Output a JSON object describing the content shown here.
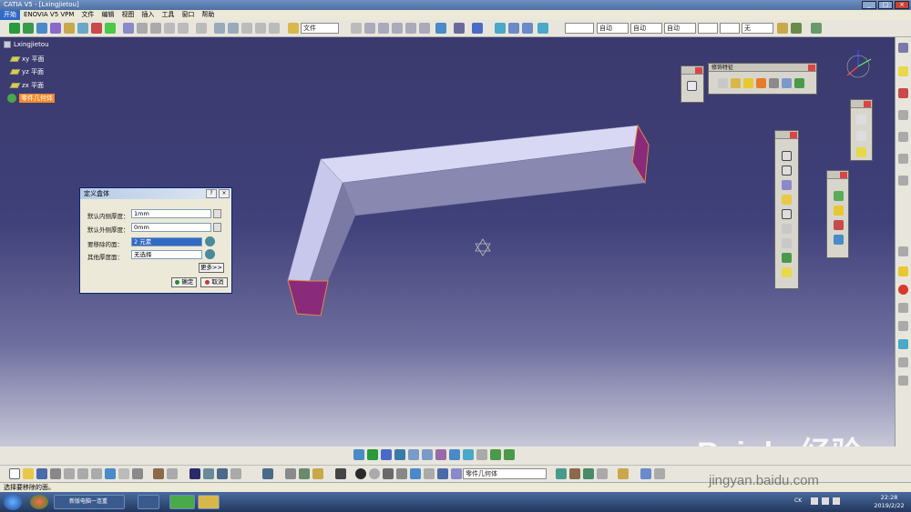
{
  "window": {
    "title": "CATIA V5 - [Lxingjietou]",
    "controls": [
      "_",
      "□",
      "×"
    ]
  },
  "menu": [
    "开始",
    "ENOVIA V5 VPM",
    "文件",
    "编辑",
    "视图",
    "插入",
    "工具",
    "窗口",
    "帮助"
  ],
  "toolbar": {
    "file_select": "文件",
    "line_style": "自动",
    "line_weight": "自动",
    "color": "自动",
    "layer": "无"
  },
  "tree": {
    "root": "Lxingjietou",
    "items": [
      "xy 平面",
      "yz 平面",
      "zx 平面",
      "零件几何体"
    ]
  },
  "palettes": {
    "decoration": "修饰特征"
  },
  "dialog": {
    "title": "定义盒体",
    "help": "?",
    "close": "×",
    "inner_label": "默认内侧厚度：",
    "inner_value": "1mm",
    "outer_label": "默认外侧厚度：",
    "outer_value": "0mm",
    "faces_label": "要移除的面：",
    "faces_value": "2 元素",
    "other_label": "其他厚度面：",
    "other_value": "无选择",
    "more": "更多>>",
    "ok": "确定",
    "cancel": "取消"
  },
  "bottom_toolbar": {
    "body_select": "零件几何体"
  },
  "status": "选择要移除的面。",
  "taskbar": {
    "browser": "新版电脑一连重",
    "time": "22:28",
    "date": "2019/2/22",
    "lang": "CK"
  },
  "watermark": {
    "brand": "Bai du 经验",
    "url": "jingyan.baidu.com"
  },
  "colors": {
    "viewport_top": "#3a3a6e",
    "part": "#c8c8f0",
    "face": "#8a2a7a",
    "selection": "#316ac5"
  }
}
